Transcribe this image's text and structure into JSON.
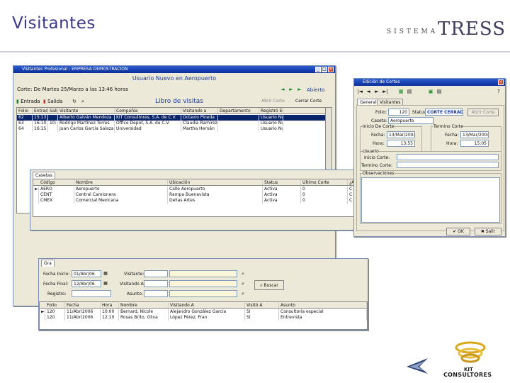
{
  "slide": {
    "title": "Visitantes",
    "brand_small": "SISTEMA",
    "brand_big": "TRESS",
    "logo_line1": "KIT",
    "logo_line2": "CONSULTORES"
  },
  "main": {
    "title": "Visitantes Profesional : EMPRESA DEMOSTRACION",
    "header": "Usuario Nuevo en Aeropuerto",
    "corte": "Corte: De Martes 25/Marzo a las 13:46 horas",
    "status": "Abierto",
    "btn_entrada": "Entrada",
    "btn_salida": "Salida",
    "libro": "Libro de visitas",
    "btn_abrir": "Abrir Corte",
    "btn_cerrar": "Cerrar Corte",
    "columns": [
      "Folio",
      "Entrada",
      "Salida",
      "Visitante",
      "Compañía",
      "Visitando a",
      "Departamento",
      "Registró En"
    ],
    "rows": [
      [
        "62",
        "15:13",
        "",
        "Alberto Galván Mendoza",
        "KIT Consultores, S.A. de C.V.",
        "Octavio Pineda",
        "",
        "Usuario Nu"
      ],
      [
        "63",
        "16:10",
        "10:",
        "Rodrigo Martínez Torres",
        "Office Depot, S.A. de C.V.",
        "Claudia Ramírez",
        "",
        "Usuario Nu"
      ],
      [
        "64",
        "16:15",
        "",
        "Juan Carlos García Salazar",
        "Universidad",
        "Martha Hernán",
        "",
        "Usuario Nu"
      ]
    ]
  },
  "casetas": {
    "tab": "Casetas",
    "columns": [
      "Código",
      "Nombre",
      "Ubicación",
      "Status",
      "Ultimo Corte",
      "¿Abierta?"
    ],
    "rows": [
      [
        "AERO",
        "Aeropuerto",
        "Calle Aeropuerto",
        "Activa",
        "0",
        "C"
      ],
      [
        "CENT",
        "Central Camionera",
        "Rampa Buenavista",
        "Activa",
        "0",
        "C"
      ],
      [
        "CMEX",
        "Comercial Mexicana",
        "Delias Artes",
        "Activa",
        "0",
        "C"
      ]
    ]
  },
  "cortes": {
    "title": "Edición de Cortes",
    "tabs": [
      "Generales",
      "Visitantes"
    ],
    "folio_label": "Folio:",
    "folio": "120",
    "status_label": "Status:",
    "status": "CORTE CERRADO",
    "caseta_label": "Caseta:",
    "caseta": "Aeropuerto",
    "inicio_group": "Inicio De Corte",
    "termino_group": "Termino Corte",
    "fecha_label": "Fecha:",
    "fecha_inicio": "13/Mar/2004",
    "hora_label": "Hora:",
    "hora_inicio": "13:55",
    "fecha_fin": "13/Mar/2004",
    "hora_fin": "15:05",
    "usuario_group": "Usuario",
    "inicio_corte": "Inicio Corte:",
    "termino_corte": "Termino Corte:",
    "obs": "Observaciones:"
  },
  "search": {
    "tab": "Gra",
    "fecha_inicio_label": "Fecha Inicio:",
    "fecha_inicio": "01/Abr/06",
    "fecha_final_label": "Fecha Final:",
    "fecha_final": "12/Abr/06",
    "registro_label": "Registro:",
    "visitante_label": "Visitante:",
    "visitando_label": "Visitando A:",
    "asunto_label": "Asunto:",
    "buscar": "Buscar",
    "columns": [
      "Folio",
      "Fecha",
      "Hora",
      "Nombre",
      "Visitando A",
      "Visitó A",
      "Asunto"
    ],
    "rows": [
      [
        "120",
        "11/Abr/2006",
        "10:00",
        "Bernard, Nicole",
        "Alejandro González García",
        "Sí",
        "Consultoría especial"
      ],
      [
        "120",
        "11/Abr/2006",
        "12:10",
        "Rosas Brito, Oliva",
        "López Pérez, Fran",
        "Sí",
        "Entrevista"
      ]
    ]
  }
}
